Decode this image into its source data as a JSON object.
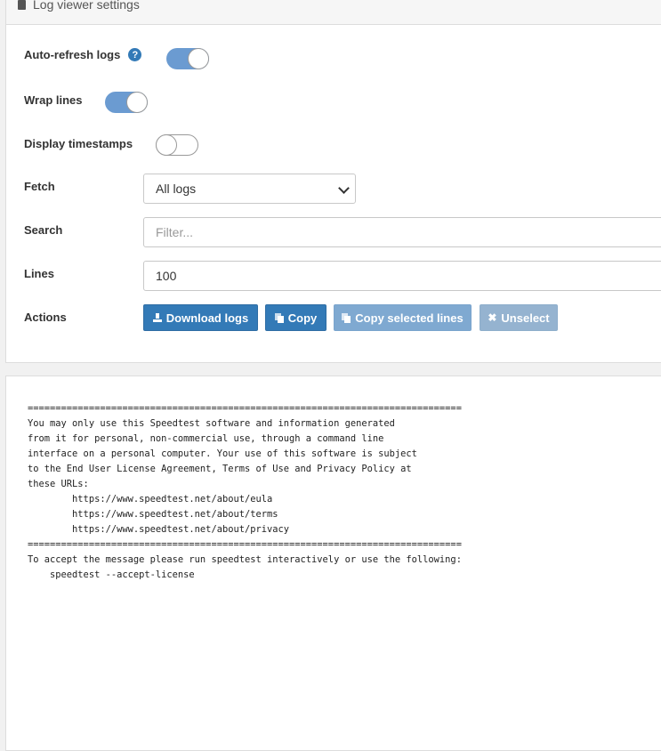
{
  "panel": {
    "title": "Log viewer settings",
    "title_icon": "document-icon"
  },
  "settings": {
    "auto_refresh": {
      "label": "Auto-refresh logs",
      "help_glyph": "?",
      "enabled": true
    },
    "wrap_lines": {
      "label": "Wrap lines",
      "enabled": true
    },
    "display_timestamps": {
      "label": "Display timestamps",
      "enabled": false
    },
    "fetch": {
      "label": "Fetch",
      "selected": "All logs"
    },
    "search": {
      "label": "Search",
      "value": "",
      "placeholder": "Filter..."
    },
    "lines": {
      "label": "Lines",
      "value": "100"
    },
    "actions": {
      "label": "Actions",
      "download": "Download logs",
      "copy": "Copy",
      "copy_selected": "Copy selected lines",
      "unselect": "Unselect"
    }
  },
  "log": {
    "lines": [
      "==============================================================================",
      "You may only use this Speedtest software and information generated",
      "from it for personal, non-commercial use, through a command line",
      "interface on a personal computer. Your use of this software is subject",
      "to the End User License Agreement, Terms of Use and Privacy Policy at",
      "these URLs:",
      "        https://www.speedtest.net/about/eula",
      "        https://www.speedtest.net/about/terms",
      "        https://www.speedtest.net/about/privacy",
      "==============================================================================",
      "To accept the message please run speedtest interactively or use the following:",
      "    speedtest --accept-license"
    ]
  },
  "colors": {
    "primary": "#337ab7",
    "toggle_on": "#6b9bd1",
    "disabled_button": "#7fa9d1"
  }
}
